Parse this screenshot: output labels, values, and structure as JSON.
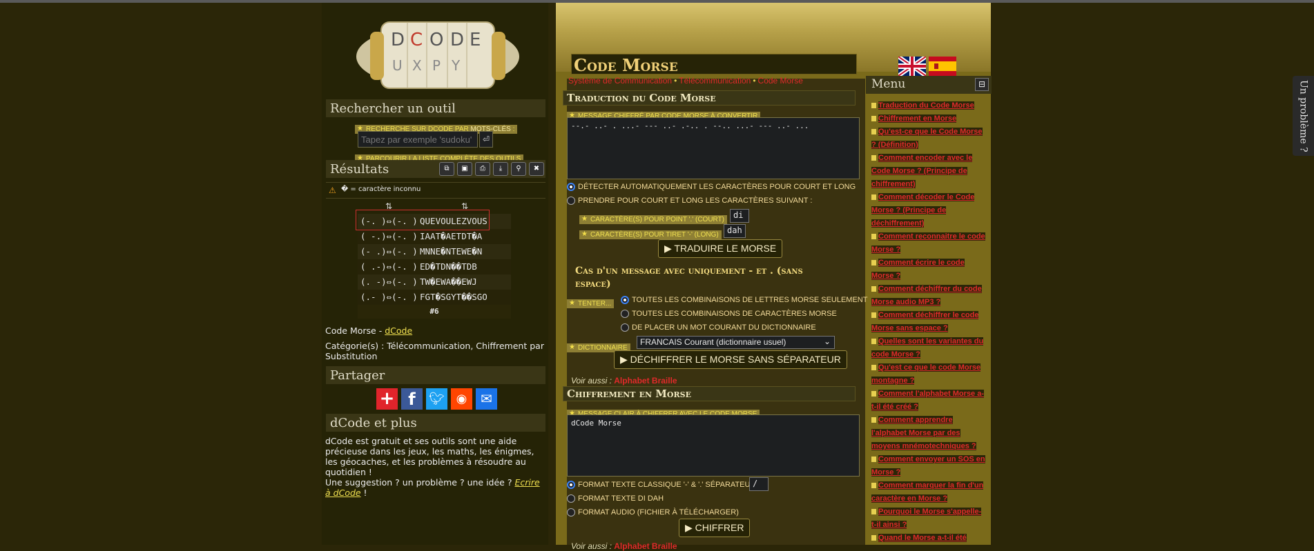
{
  "left": {
    "search_title": "Rechercher un outil",
    "search_tag_pre": "Recherche sur dCode par ",
    "search_tag_em": "mots-clés",
    "search_tag_post": " :",
    "search_placeholder": "Tapez par exemple 'sudoku'",
    "search_go": "⏎",
    "browse_pre": "Parcourir la ",
    "browse_link": "liste complète des outils",
    "results_title": "Résultats",
    "results_buttons": [
      "copy-icon",
      "save-icon",
      "print-icon",
      "download-icon",
      "pin-icon",
      "close-icon"
    ],
    "warning": "� = caractère inconnu",
    "col_icon": "⇅",
    "rows": [
      {
        "code": "(-. )⇔(-. )",
        "text": "QUEVOULEZVOUS"
      },
      {
        "code": "( -.)⇔(-. )",
        "text": "IAAT�AETDT�A"
      },
      {
        "code": "(- .)⇔(-. )",
        "text": "MNNE�NTEWE�N"
      },
      {
        "code": "( .-)⇔(-. )",
        "text": "ED�TDN��TDB"
      },
      {
        "code": "(. -)⇔(-. )",
        "text": "TW�EWA��EWJ"
      },
      {
        "code": "(.- )⇔(-. )",
        "text": "FGT�SGYT��SGO"
      }
    ],
    "rows_footer": "#6",
    "tool_line_pre": "Code Morse - ",
    "tool_line_link": "dCode",
    "categories": "Catégorie(s) : Télécommunication, Chiffrement par Substitution",
    "share_title": "Partager",
    "share_icons": [
      "plus-icon",
      "facebook-icon",
      "twitter-icon",
      "reddit-icon",
      "email-icon"
    ],
    "more_title": "dCode et plus",
    "more_text": "dCode est gratuit et ses outils sont une aide précieuse dans les jeux, les maths, les énigmes, les géocaches, et les problèmes à résoudre au quotidien !",
    "more_text2": "Une suggestion ? un problème ? une idée ? ",
    "more_link": "Ecrire à dCode",
    "more_end": " !"
  },
  "center": {
    "title": "Code Morse",
    "breadcrumb": [
      "Système de Communication",
      "Télécommunication",
      "Code Morse"
    ],
    "decode": {
      "header": "Traduction du Code Morse",
      "msg_label": "Message chiffré par code Morse à convertir",
      "msg_value": "--.- ..- . ...- --- ..- .-.. . --.. ...- --- ..- ...",
      "opt_auto": "Détecter automatiquement les caractères pour court et long",
      "opt_custom": "Prendre pour court et long les caractères suivant :",
      "dot_label": "Caractère(s) pour point '.' (court)",
      "dot_value": "di",
      "dash_label": "Caractère(s) pour tiret '-' (long)",
      "dash_value": "dah",
      "btn": "▶ TRADUIRE LE MORSE"
    },
    "nosep": {
      "title": "Cas d'un message avec uniquement - et . (sans espace)",
      "try_label": "Tenter...",
      "opt1": "Toutes les combinaisons de lettres Morse seulement",
      "opt2": "Toutes les combinaisons de caractères Morse",
      "opt3": "De placer un mot courant du dictionnaire",
      "dict_label": "Dictionnaire",
      "dict_value": "FRANCAIS Courant (dictionnaire usuel)",
      "btn": "▶ DÉCHIFFRER LE MORSE SANS SÉPARATEUR",
      "see_also": "Voir aussi : ",
      "see_link": "Alphabet Braille"
    },
    "encode": {
      "header": "Chiffrement en Morse",
      "msg_label": "Message clair à chiffrer avec le code Morse",
      "msg_value": "dCode Morse",
      "opt1": "Format texte classique '-' & '.' séparateur =",
      "sep_value": "/",
      "opt2": "Format texte DI DAH",
      "opt3": "Format audio (fichier à télécharger)",
      "btn": "▶ CHIFFRER",
      "see_also": "Voir aussi : ",
      "see_link": "Alphabet Braille"
    }
  },
  "menu": {
    "title": "Menu",
    "toggle": "⊟",
    "items": [
      "Traduction du Code Morse",
      "Chiffrement en Morse",
      "Qu'est-ce que le Code Morse ? (Définition)",
      "Comment encoder avec le Code Morse ? (Principe de chiffrement)",
      "Comment décoder le Code Morse ? (Principe de déchiffrement)",
      "Comment reconnaitre le code Morse ?",
      "Comment écrire le code Morse ?",
      "Comment déchiffrer du code Morse audio MP3 ?",
      "Comment déchiffrer le code Morse sans espace ?",
      "Quelles sont les variantes du code Morse ?",
      "Qu'est ce que le code Morse montagne ?",
      "Comment l'alphabet Morse a-t-il été créé ?",
      "Comment apprendre l'alphabet Morse par des moyens mnémotechniques ?",
      "Comment envoyer un SOS en Morse ?",
      "Comment marquer la fin d'un caractère en Morse ?",
      "Pourquoi le Morse s'appelle-t-il ainsi ?",
      "Quand le Morse a-t-il été"
    ]
  },
  "problem_tab": "Un problème ?",
  "colors": {
    "accent_red": "#e02a2a",
    "gold": "#e8d050",
    "bg": "#2b2608"
  }
}
